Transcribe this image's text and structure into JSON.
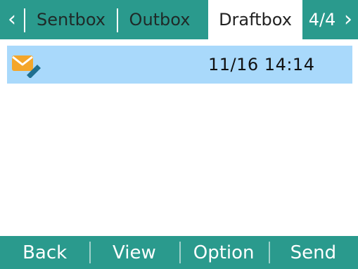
{
  "tabs": [
    {
      "label": "Sentbox",
      "active": false
    },
    {
      "label": "Outbox",
      "active": false
    },
    {
      "label": "Draftbox",
      "active": true
    }
  ],
  "page_counter": "4/4",
  "nav": {
    "prev_icon": "chevron-left-icon",
    "next_icon": "chevron-right-icon"
  },
  "messages": [
    {
      "icon": "draft-envelope-icon",
      "timestamp": "11/16 14:14",
      "selected": true
    }
  ],
  "softkeys": [
    {
      "label": "Back"
    },
    {
      "label": "View"
    },
    {
      "label": "Option"
    },
    {
      "label": "Send"
    }
  ],
  "colors": {
    "bar": "#2a9a8d",
    "selected_row": "#a9d9fb",
    "envelope": "#f4a62a",
    "pencil": "#1f6f8f"
  }
}
